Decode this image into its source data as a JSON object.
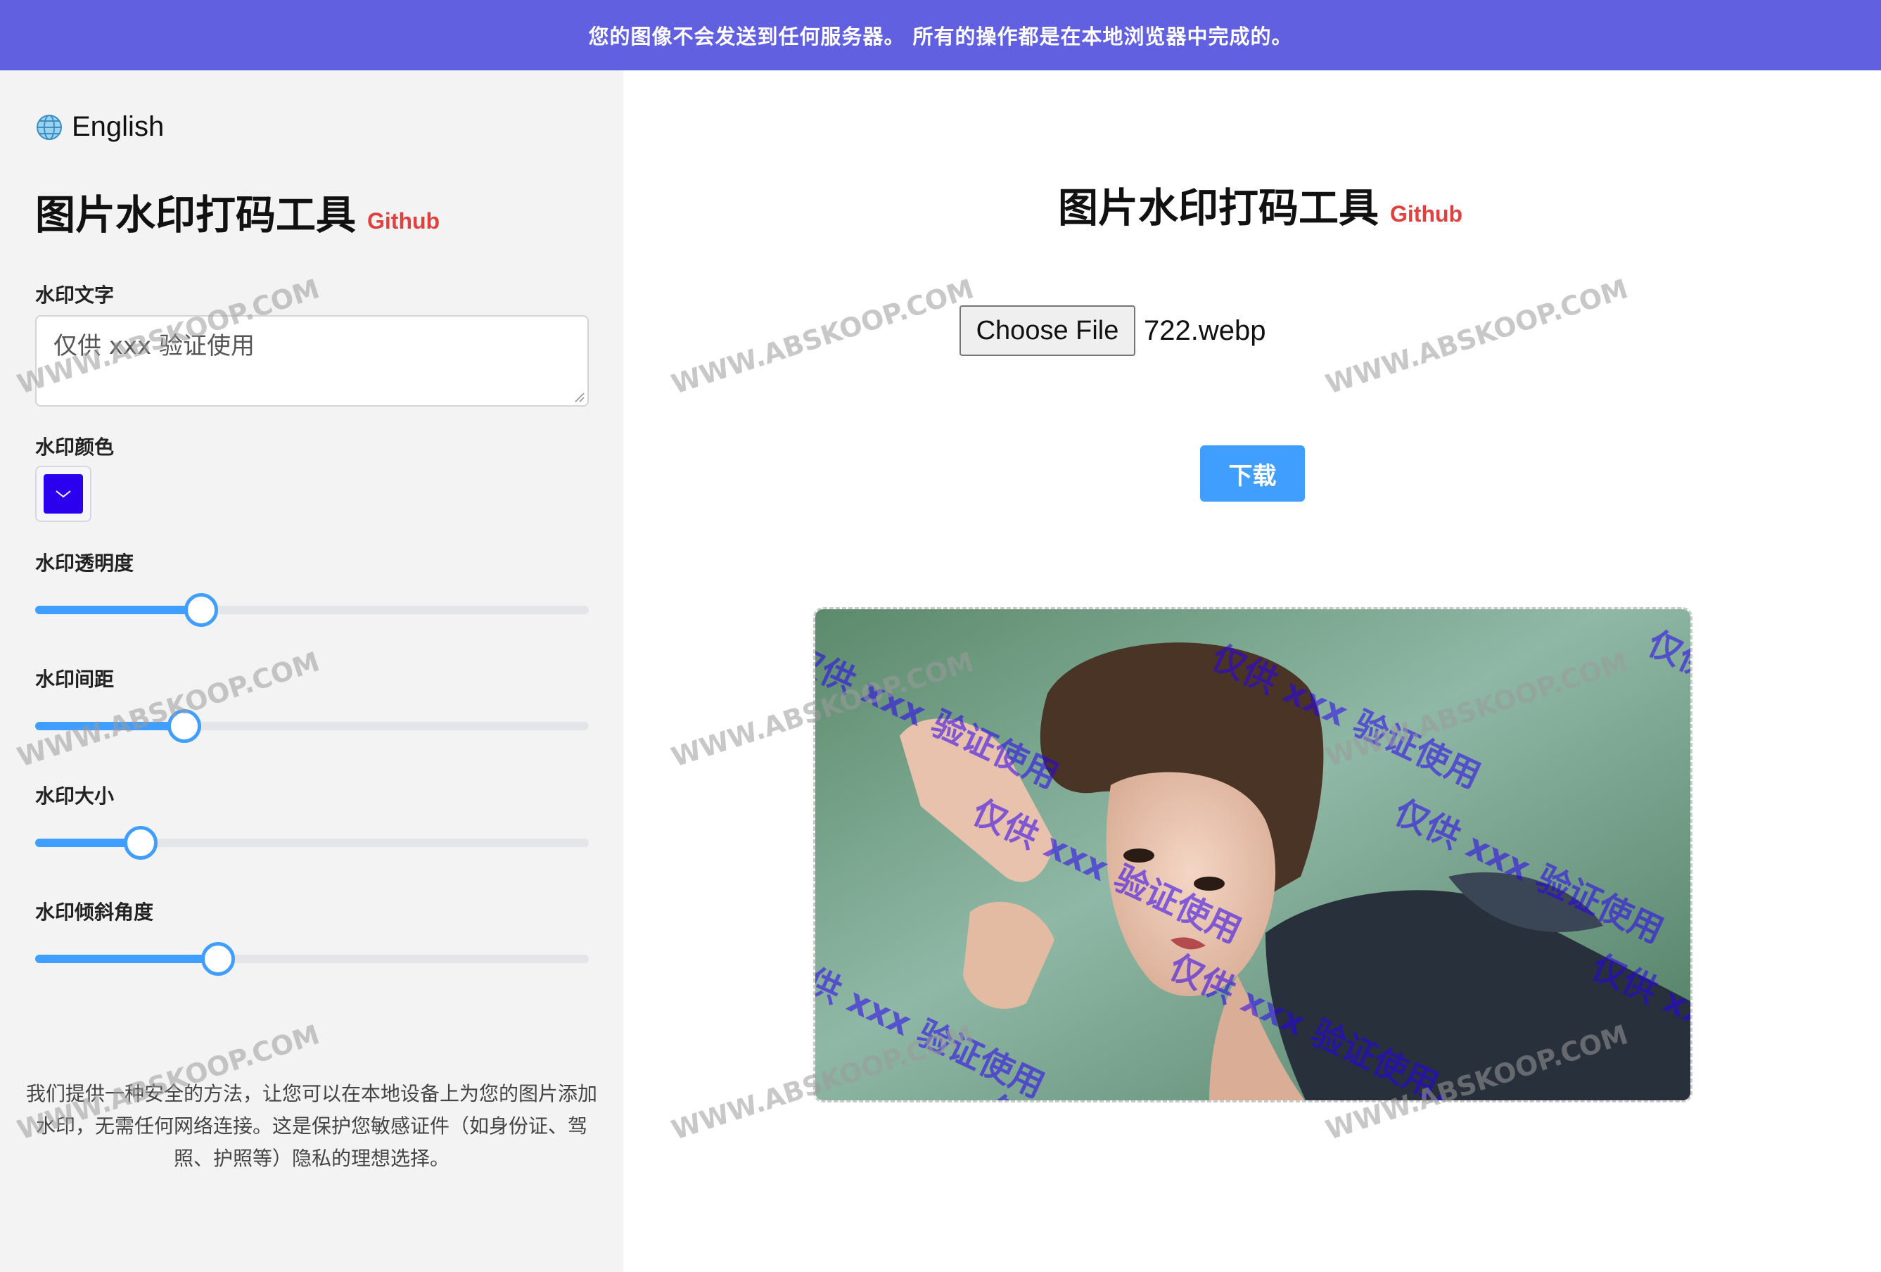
{
  "banner": {
    "text": "您的图像不会发送到任何服务器。 所有的操作都是在本地浏览器中完成的。"
  },
  "sidebar": {
    "language": {
      "icon": "globe-icon",
      "label": "English"
    },
    "title": "图片水印打码工具",
    "github_label": "Github",
    "watermark_text": {
      "label": "水印文字",
      "value": "仅供 xxx 验证使用"
    },
    "watermark_color": {
      "label": "水印颜色",
      "value": "#2a00ee"
    },
    "sliders": [
      {
        "label": "水印透明度",
        "level": 0.3
      },
      {
        "label": "水印间距",
        "level": 0.27
      },
      {
        "label": "水印大小",
        "level": 0.19
      },
      {
        "label": "水印倾斜角度",
        "level": 0.33
      }
    ],
    "intro": "我们提供一种安全的方法，让您可以在本地设备上为您的图片添加水印，无需任何网络连接。这是保护您敏感证件（如身份证、驾照、护照等）隐私的理想选择。"
  },
  "main": {
    "title": "图片水印打码工具",
    "github_label": "Github",
    "choose_file_label": "Choose File",
    "file_name": "722.webp",
    "download_label": "下载",
    "preview_watermark": "仅供 xxx 验证使用",
    "preview_watermark_color": "#2a00ee"
  },
  "site_watermark": "WWW.ABSKOOP.COM",
  "colors": {
    "banner": "#6160e0",
    "accent": "#409eff",
    "github": "#e0413f",
    "sidebar_bg": "#f3f3f4"
  }
}
